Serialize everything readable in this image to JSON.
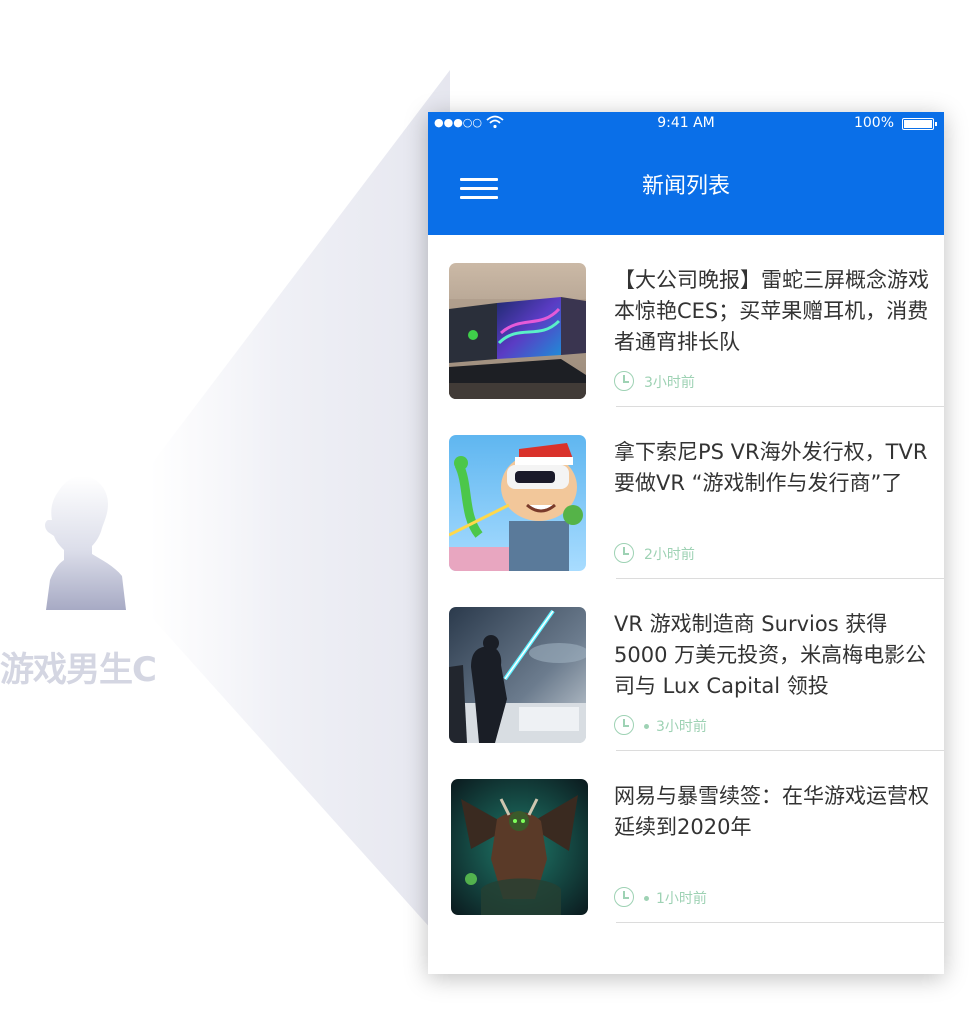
{
  "persona": {
    "name": "游戏男生C"
  },
  "status_bar": {
    "time": "9:41 AM",
    "battery": "100%"
  },
  "nav": {
    "title": "新闻列表"
  },
  "news": [
    {
      "title": "【大公司晚报】雷蛇三屏概念游戏本惊艳CES；买苹果赠耳机，消费者通宵排长队",
      "time": "3小时前",
      "dot": false
    },
    {
      "title": "拿下索尼PS VR海外发行权，TVR要做VR “游戏制作与发行商”了",
      "time": "2小时前",
      "dot": false
    },
    {
      "title": "VR 游戏制造商 Survios 获得 5000 万美元投资，米高梅电影公司与 Lux Capital 领投",
      "time": "3小时前",
      "dot": true
    },
    {
      "title": "网易与暴雪续签：在华游戏运营权延续到2020年",
      "time": "1小时前",
      "dot": true
    }
  ]
}
